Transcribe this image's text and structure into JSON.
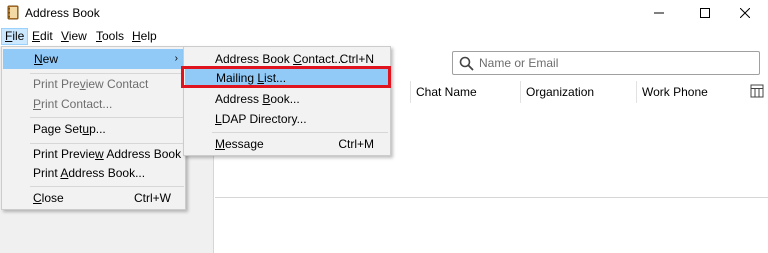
{
  "window": {
    "title": "Address Book",
    "app_icon": "address-book-icon"
  },
  "menubar": {
    "items": [
      {
        "label": "File",
        "underline": "F",
        "rest": "ile"
      },
      {
        "label": "Edit",
        "underline": "E",
        "rest": "dit"
      },
      {
        "label": "View",
        "underline": "V",
        "rest": "iew"
      },
      {
        "label": "Tools",
        "underline": "T",
        "rest": "ools"
      },
      {
        "label": "Help",
        "underline": "H",
        "rest": "elp"
      }
    ]
  },
  "file_menu": {
    "new": {
      "pre": "",
      "u": "N",
      "post": "ew",
      "arrow": "›"
    },
    "print_preview_contact": {
      "pre": "Print Pre",
      "u": "v",
      "post": "iew Contact"
    },
    "print_contact": {
      "pre": "",
      "u": "P",
      "post": "rint Contact..."
    },
    "page_setup": {
      "pre": "Page Set",
      "u": "u",
      "post": "p..."
    },
    "print_preview_address_book": {
      "pre": "Print Previe",
      "u": "w",
      "post": " Address Book"
    },
    "print_address_book": {
      "pre": "Print ",
      "u": "A",
      "post": "ddress Book..."
    },
    "close": {
      "pre": "",
      "u": "C",
      "post": "lose",
      "shortcut": "Ctrl+W"
    }
  },
  "new_submenu": {
    "contact": {
      "pre": "Address Book ",
      "u": "C",
      "post": "ontact...",
      "shortcut": "Ctrl+N"
    },
    "mailing_list": {
      "pre": "Mailing ",
      "u": "L",
      "post": "ist..."
    },
    "address_book": {
      "pre": "Address ",
      "u": "B",
      "post": "ook..."
    },
    "ldap": {
      "pre": "",
      "u": "L",
      "post": "DAP Directory..."
    },
    "message": {
      "pre": "",
      "u": "M",
      "post": "essage",
      "shortcut": "Ctrl+M"
    }
  },
  "search": {
    "placeholder": "Name or Email"
  },
  "columns": [
    "Chat Name",
    "Organization",
    "Work Phone"
  ],
  "colors": {
    "highlight_border": "#e0141e",
    "menu_hover": "#91c9f7",
    "menu_active": "#cce8ff"
  }
}
